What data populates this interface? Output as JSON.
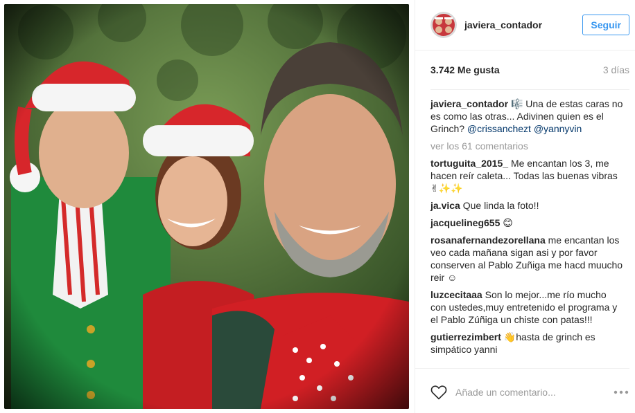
{
  "post": {
    "username": "javiera_contador",
    "follow_label": "Seguir",
    "likes": "3.742 Me gusta",
    "time_ago": "3 días"
  },
  "caption": {
    "username": "javiera_contador",
    "text": "🎼 Una de estas caras no es como las otras... Adivinen quien es el Grinch? ",
    "mention_1": "@crissanchezt",
    "mention_2": "@yannyvin"
  },
  "view_all": "ver los 61 comentarios",
  "comments": [
    {
      "user": "tortuguita_2015_",
      "text": "Me encantan los 3, me hacen reír caleta... Todas las buenas vibras ✌✨✨"
    },
    {
      "user": "ja.vica",
      "text": "Que linda la foto!!"
    },
    {
      "user": "jacquelineg655",
      "text": "😊"
    },
    {
      "user": "rosanafernandezorellana",
      "text": "me encantan los veo cada mañana sigan asi y por favor conserven al Pablo Zuñiga me hacd muucho reir ☺"
    },
    {
      "user": "luzcecitaaa",
      "text": "Son lo mejor...me río mucho con ustedes,muy entretenido el programa y el Pablo Zúñiga un chiste con patas!!!"
    },
    {
      "user": "gutierrezimbert",
      "text": "👋hasta de grinch es simpático yanni"
    }
  ],
  "add_comment": {
    "placeholder": "Añade un comentario..."
  },
  "icons": {
    "like": "heart-icon",
    "more": "more-options-icon"
  },
  "colors": {
    "accent": "#3897f0",
    "mention": "#003569",
    "muted": "#999999"
  }
}
